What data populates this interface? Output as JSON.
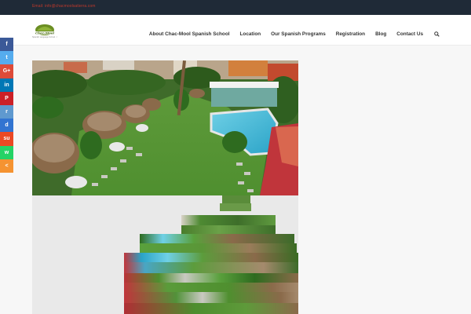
{
  "topbar": {
    "email": "Email: info@chacmoolsatierra.com"
  },
  "logo": {
    "name": "Chac-Mool",
    "tagline": "Spanish Language School · Cuernavaca"
  },
  "nav": {
    "items": [
      "About Chac-Mool Spanish School",
      "Location",
      "Our Spanish Programs",
      "Registration",
      "Blog",
      "Contact Us"
    ]
  },
  "social": {
    "buttons": [
      {
        "label": "f",
        "icon": "facebook-icon",
        "color": "#3b5998"
      },
      {
        "label": "t",
        "icon": "twitter-icon",
        "color": "#55acee"
      },
      {
        "label": "G+",
        "icon": "google-plus-icon",
        "color": "#dd4b39"
      },
      {
        "label": "in",
        "icon": "linkedin-icon",
        "color": "#0077b5"
      },
      {
        "label": "P",
        "icon": "pinterest-icon",
        "color": "#cb2027"
      },
      {
        "label": "r",
        "icon": "reddit-icon",
        "color": "#5f99cf"
      },
      {
        "label": "d",
        "icon": "delicious-icon",
        "color": "#3274d1"
      },
      {
        "label": "su",
        "icon": "stumbleupon-icon",
        "color": "#eb4924"
      },
      {
        "label": "w",
        "icon": "whatsapp-icon",
        "color": "#25d366"
      },
      {
        "label": "<",
        "icon": "share-icon",
        "color": "#f59331"
      }
    ]
  },
  "colors": {
    "topbar": "#1f2a37",
    "accent": "#c0392b"
  }
}
